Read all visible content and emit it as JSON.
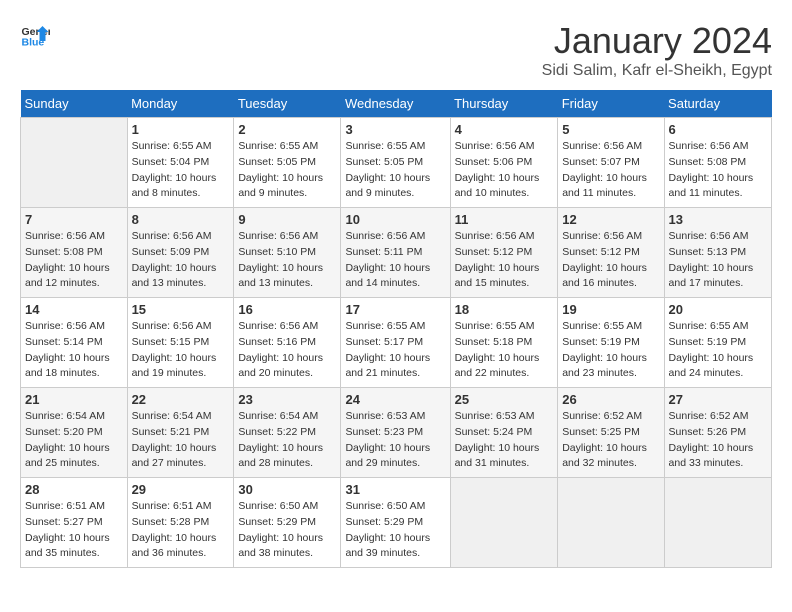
{
  "logo": {
    "text_general": "General",
    "text_blue": "Blue"
  },
  "title": "January 2024",
  "subtitle": "Sidi Salim, Kafr el-Sheikh, Egypt",
  "days_header": [
    "Sunday",
    "Monday",
    "Tuesday",
    "Wednesday",
    "Thursday",
    "Friday",
    "Saturday"
  ],
  "weeks": [
    [
      {
        "num": "",
        "sunrise": "",
        "sunset": "",
        "daylight": "",
        "empty": true
      },
      {
        "num": "1",
        "sunrise": "Sunrise: 6:55 AM",
        "sunset": "Sunset: 5:04 PM",
        "daylight": "Daylight: 10 hours and 8 minutes."
      },
      {
        "num": "2",
        "sunrise": "Sunrise: 6:55 AM",
        "sunset": "Sunset: 5:05 PM",
        "daylight": "Daylight: 10 hours and 9 minutes."
      },
      {
        "num": "3",
        "sunrise": "Sunrise: 6:55 AM",
        "sunset": "Sunset: 5:05 PM",
        "daylight": "Daylight: 10 hours and 9 minutes."
      },
      {
        "num": "4",
        "sunrise": "Sunrise: 6:56 AM",
        "sunset": "Sunset: 5:06 PM",
        "daylight": "Daylight: 10 hours and 10 minutes."
      },
      {
        "num": "5",
        "sunrise": "Sunrise: 6:56 AM",
        "sunset": "Sunset: 5:07 PM",
        "daylight": "Daylight: 10 hours and 11 minutes."
      },
      {
        "num": "6",
        "sunrise": "Sunrise: 6:56 AM",
        "sunset": "Sunset: 5:08 PM",
        "daylight": "Daylight: 10 hours and 11 minutes."
      }
    ],
    [
      {
        "num": "7",
        "sunrise": "Sunrise: 6:56 AM",
        "sunset": "Sunset: 5:08 PM",
        "daylight": "Daylight: 10 hours and 12 minutes."
      },
      {
        "num": "8",
        "sunrise": "Sunrise: 6:56 AM",
        "sunset": "Sunset: 5:09 PM",
        "daylight": "Daylight: 10 hours and 13 minutes."
      },
      {
        "num": "9",
        "sunrise": "Sunrise: 6:56 AM",
        "sunset": "Sunset: 5:10 PM",
        "daylight": "Daylight: 10 hours and 13 minutes."
      },
      {
        "num": "10",
        "sunrise": "Sunrise: 6:56 AM",
        "sunset": "Sunset: 5:11 PM",
        "daylight": "Daylight: 10 hours and 14 minutes."
      },
      {
        "num": "11",
        "sunrise": "Sunrise: 6:56 AM",
        "sunset": "Sunset: 5:12 PM",
        "daylight": "Daylight: 10 hours and 15 minutes."
      },
      {
        "num": "12",
        "sunrise": "Sunrise: 6:56 AM",
        "sunset": "Sunset: 5:12 PM",
        "daylight": "Daylight: 10 hours and 16 minutes."
      },
      {
        "num": "13",
        "sunrise": "Sunrise: 6:56 AM",
        "sunset": "Sunset: 5:13 PM",
        "daylight": "Daylight: 10 hours and 17 minutes."
      }
    ],
    [
      {
        "num": "14",
        "sunrise": "Sunrise: 6:56 AM",
        "sunset": "Sunset: 5:14 PM",
        "daylight": "Daylight: 10 hours and 18 minutes."
      },
      {
        "num": "15",
        "sunrise": "Sunrise: 6:56 AM",
        "sunset": "Sunset: 5:15 PM",
        "daylight": "Daylight: 10 hours and 19 minutes."
      },
      {
        "num": "16",
        "sunrise": "Sunrise: 6:56 AM",
        "sunset": "Sunset: 5:16 PM",
        "daylight": "Daylight: 10 hours and 20 minutes."
      },
      {
        "num": "17",
        "sunrise": "Sunrise: 6:55 AM",
        "sunset": "Sunset: 5:17 PM",
        "daylight": "Daylight: 10 hours and 21 minutes."
      },
      {
        "num": "18",
        "sunrise": "Sunrise: 6:55 AM",
        "sunset": "Sunset: 5:18 PM",
        "daylight": "Daylight: 10 hours and 22 minutes."
      },
      {
        "num": "19",
        "sunrise": "Sunrise: 6:55 AM",
        "sunset": "Sunset: 5:19 PM",
        "daylight": "Daylight: 10 hours and 23 minutes."
      },
      {
        "num": "20",
        "sunrise": "Sunrise: 6:55 AM",
        "sunset": "Sunset: 5:19 PM",
        "daylight": "Daylight: 10 hours and 24 minutes."
      }
    ],
    [
      {
        "num": "21",
        "sunrise": "Sunrise: 6:54 AM",
        "sunset": "Sunset: 5:20 PM",
        "daylight": "Daylight: 10 hours and 25 minutes."
      },
      {
        "num": "22",
        "sunrise": "Sunrise: 6:54 AM",
        "sunset": "Sunset: 5:21 PM",
        "daylight": "Daylight: 10 hours and 27 minutes."
      },
      {
        "num": "23",
        "sunrise": "Sunrise: 6:54 AM",
        "sunset": "Sunset: 5:22 PM",
        "daylight": "Daylight: 10 hours and 28 minutes."
      },
      {
        "num": "24",
        "sunrise": "Sunrise: 6:53 AM",
        "sunset": "Sunset: 5:23 PM",
        "daylight": "Daylight: 10 hours and 29 minutes."
      },
      {
        "num": "25",
        "sunrise": "Sunrise: 6:53 AM",
        "sunset": "Sunset: 5:24 PM",
        "daylight": "Daylight: 10 hours and 31 minutes."
      },
      {
        "num": "26",
        "sunrise": "Sunrise: 6:52 AM",
        "sunset": "Sunset: 5:25 PM",
        "daylight": "Daylight: 10 hours and 32 minutes."
      },
      {
        "num": "27",
        "sunrise": "Sunrise: 6:52 AM",
        "sunset": "Sunset: 5:26 PM",
        "daylight": "Daylight: 10 hours and 33 minutes."
      }
    ],
    [
      {
        "num": "28",
        "sunrise": "Sunrise: 6:51 AM",
        "sunset": "Sunset: 5:27 PM",
        "daylight": "Daylight: 10 hours and 35 minutes."
      },
      {
        "num": "29",
        "sunrise": "Sunrise: 6:51 AM",
        "sunset": "Sunset: 5:28 PM",
        "daylight": "Daylight: 10 hours and 36 minutes."
      },
      {
        "num": "30",
        "sunrise": "Sunrise: 6:50 AM",
        "sunset": "Sunset: 5:29 PM",
        "daylight": "Daylight: 10 hours and 38 minutes."
      },
      {
        "num": "31",
        "sunrise": "Sunrise: 6:50 AM",
        "sunset": "Sunset: 5:29 PM",
        "daylight": "Daylight: 10 hours and 39 minutes."
      },
      {
        "num": "",
        "sunrise": "",
        "sunset": "",
        "daylight": "",
        "empty": true
      },
      {
        "num": "",
        "sunrise": "",
        "sunset": "",
        "daylight": "",
        "empty": true
      },
      {
        "num": "",
        "sunrise": "",
        "sunset": "",
        "daylight": "",
        "empty": true
      }
    ]
  ]
}
